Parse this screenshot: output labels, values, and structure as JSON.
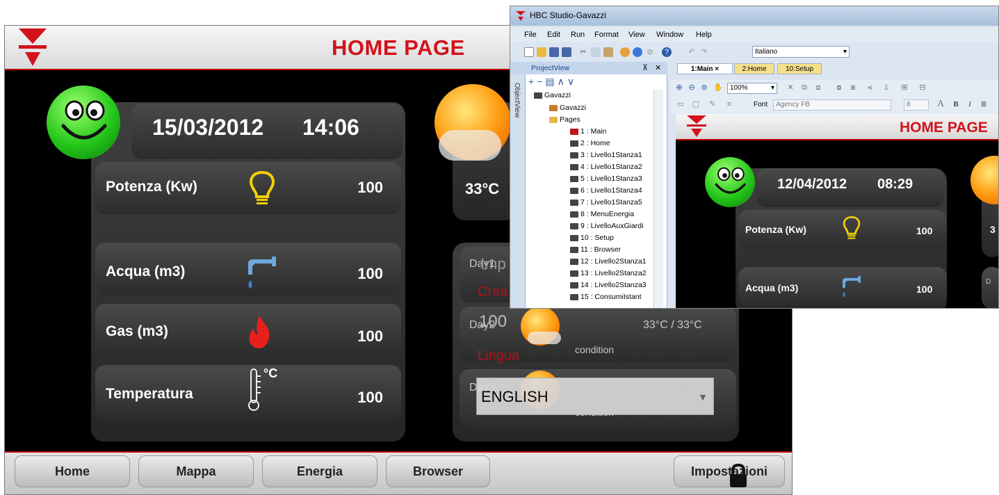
{
  "hmi": {
    "title": "HOME PAGE",
    "date": "15/03/2012",
    "time": "14:06",
    "rows": [
      {
        "label": "Potenza (Kw)",
        "value": "100",
        "icon": "bulb-icon"
      },
      {
        "label": "Acqua (m3)",
        "value": "100",
        "icon": "tap-icon"
      },
      {
        "label": "Gas (m3)",
        "value": "100",
        "icon": "flame-icon"
      },
      {
        "label": "Temperatura",
        "value": "100",
        "icon": "thermometer-icon"
      }
    ],
    "thermo_unit": "°C",
    "weather_temp": "33°C",
    "days": [
      {
        "label": "Day1"
      },
      {
        "label": "Day2",
        "temps": "33°C  / 33°C",
        "condition": "condition"
      },
      {
        "label": "Day3",
        "temps": "33°C  / 33°C",
        "condition": "condition"
      }
    ],
    "overlay": {
      "imp_label": "Imp",
      "crea_label": "Crea",
      "value_label": "100",
      "lingua_label": "Lingua",
      "language_value": "ENGLISH"
    },
    "nav": [
      "Home",
      "Mappa",
      "Energia",
      "Browser",
      "Impostazioni"
    ]
  },
  "studio": {
    "window_title": "HBC Studio-Gavazzi",
    "menu": [
      "File",
      "Edit",
      "Run",
      "Format",
      "View",
      "Window",
      "Help"
    ],
    "language": "Italiano",
    "zoom": "100%",
    "font_label": "Font",
    "font_name": "Agency FB",
    "font_size": "8",
    "projectview_title": "ProjectView",
    "objectview_label": "ObjectView",
    "tree_root": "Gavazzi",
    "tree_child": "Gavazzi",
    "tree_pages": "Pages",
    "pages": [
      "1 : Main",
      "2 : Home",
      "3 : Livello1Stanza1",
      "4 : Livello1Stanza2",
      "5 : Livello1Stanza3",
      "6 : Livello1Stanza4",
      "7 : Livello1Stanza5",
      "8 : MenuEnergia",
      "9 : LivelloAuxGiardi",
      "10 : Setup",
      "11 : Browser",
      "12 : Livello2Stanza1",
      "13 : Livello2Stanza2",
      "14 : Livello2Stanza3",
      "15 : ConsumiIstant"
    ],
    "doc_tabs": [
      "1:Main",
      "2:Home",
      "10:Setup"
    ],
    "preview": {
      "title": "HOME PAGE",
      "date": "12/04/2012",
      "time": "08:29",
      "potenza_label": "Potenza (Kw)",
      "potenza_value": "100",
      "acqua_label": "Acqua (m3)",
      "acqua_value": "100",
      "right_val": "3",
      "day_label": "D"
    }
  },
  "colors": {
    "accent_red": "#d3121b",
    "panel_dark": "#2b2b2b",
    "studio_blue": "#c5d6ec"
  }
}
